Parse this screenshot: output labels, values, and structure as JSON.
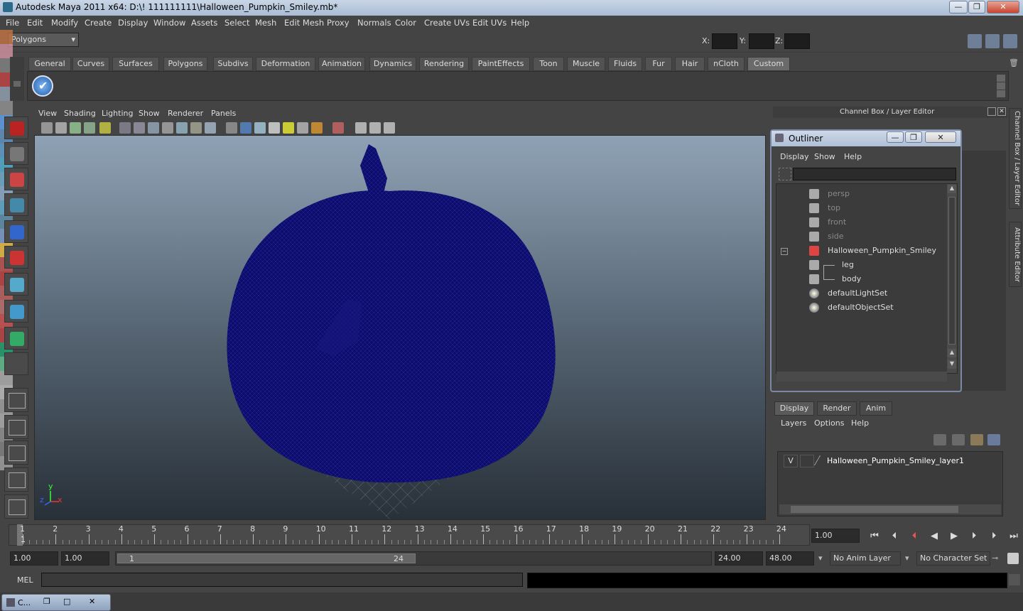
{
  "window": {
    "title": "Autodesk Maya 2011 x64: D:\\! 111111111\\Halloween_Pumpkin_Smiley.mb*",
    "min": "—",
    "max": "❐",
    "close": "✕"
  },
  "menu": [
    "File",
    "Edit",
    "Modify",
    "Create",
    "Display",
    "Window",
    "Assets",
    "Select",
    "Mesh",
    "Edit Mesh",
    "Proxy",
    "Normals",
    "Color",
    "Create UVs",
    "Edit UVs",
    "Help"
  ],
  "status": {
    "mode": "Polygons",
    "x_label": "X:",
    "y_label": "Y:",
    "z_label": "Z:"
  },
  "shelf_tabs": [
    "General",
    "Curves",
    "Surfaces",
    "Polygons",
    "Subdivs",
    "Deformation",
    "Animation",
    "Dynamics",
    "Rendering",
    "PaintEffects",
    "Toon",
    "Muscle",
    "Fluids",
    "Fur",
    "Hair",
    "nCloth",
    "Custom"
  ],
  "viewport": {
    "menu": [
      "View",
      "Shading",
      "Lighting",
      "Show",
      "Renderer",
      "Panels"
    ],
    "axis_y": "y",
    "axis_x": "x",
    "axis_z": "z"
  },
  "channel_box": {
    "title": "Channel Box / Layer Editor"
  },
  "side_tabs": {
    "channel": "Channel Box / Layer Editor",
    "attribute": "Attribute Editor"
  },
  "outliner": {
    "title": "Outliner",
    "menu": [
      "Display",
      "Show",
      "Help"
    ],
    "items": [
      {
        "label": "persp",
        "type": "camera",
        "dim": true
      },
      {
        "label": "top",
        "type": "camera",
        "dim": true
      },
      {
        "label": "front",
        "type": "camera",
        "dim": true
      },
      {
        "label": "side",
        "type": "camera",
        "dim": true
      },
      {
        "label": "Halloween_Pumpkin_Smiley",
        "type": "group",
        "dim": false
      },
      {
        "label": "leg",
        "type": "mesh",
        "dim": false
      },
      {
        "label": "body",
        "type": "mesh",
        "dim": false
      },
      {
        "label": "defaultLightSet",
        "type": "set",
        "dim": false
      },
      {
        "label": "defaultObjectSet",
        "type": "set",
        "dim": false
      }
    ]
  },
  "layer_editor": {
    "tabs": [
      "Display",
      "Render",
      "Anim"
    ],
    "menu": [
      "Layers",
      "Options",
      "Help"
    ],
    "layer": {
      "visible": "V",
      "name": "Halloween_Pumpkin_Smiley_layer1"
    }
  },
  "timeline": {
    "ticks": [
      "1",
      "2",
      "3",
      "4",
      "5",
      "6",
      "7",
      "8",
      "9",
      "10",
      "11",
      "12",
      "13",
      "14",
      "15",
      "16",
      "17",
      "18",
      "19",
      "20",
      "21",
      "22",
      "23",
      "24"
    ],
    "current": "1",
    "current_time": "1.00"
  },
  "range": {
    "start": "1.00",
    "start2": "1.00",
    "slider_start": "1",
    "slider_end": "24",
    "end": "24.00",
    "end2": "48.00",
    "anim_layer": "No Anim Layer",
    "char_set": "No Character Set"
  },
  "cmd": {
    "label": "MEL"
  },
  "taskbar": {
    "item": "C..."
  },
  "colors": {
    "wire": "#0d0d70",
    "bg": "#444444",
    "accent": "#7a8aa6"
  }
}
